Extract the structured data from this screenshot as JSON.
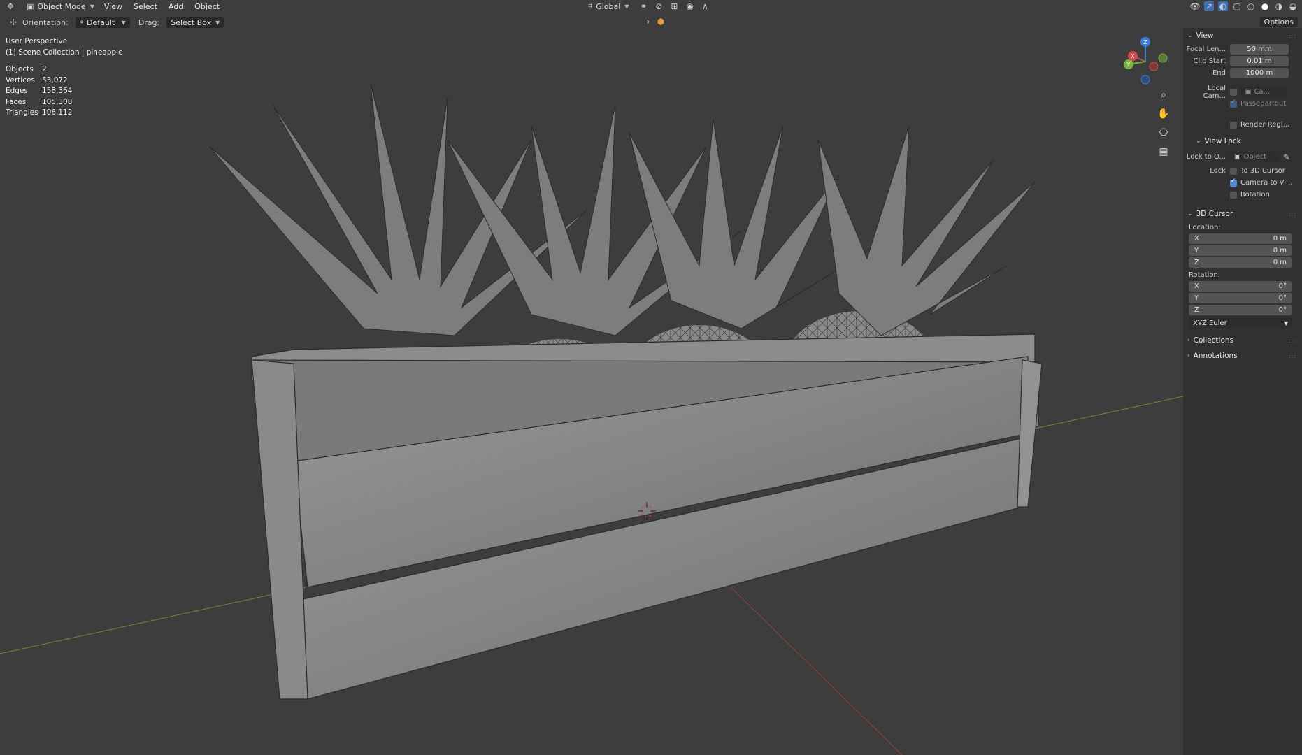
{
  "header": {
    "mode": "Object Mode",
    "menus": [
      "View",
      "Select",
      "Add",
      "Object"
    ],
    "transform_orientation": "Global"
  },
  "toolbar": {
    "orientation_label": "Orientation:",
    "orientation_value": "Default",
    "drag_label": "Drag:",
    "drag_value": "Select Box",
    "options_label": "Options"
  },
  "overlay": {
    "perspective": "User Perspective",
    "collection": "(1) Scene Collection | pineapple"
  },
  "stats": [
    {
      "label": "Objects",
      "value": "2"
    },
    {
      "label": "Vertices",
      "value": "53,072"
    },
    {
      "label": "Edges",
      "value": "158,364"
    },
    {
      "label": "Faces",
      "value": "105,308"
    },
    {
      "label": "Triangles",
      "value": "106,112"
    }
  ],
  "gizmo": {
    "x": "X",
    "y": "Y",
    "z": "Z"
  },
  "npanel": {
    "view": {
      "title": "View",
      "focal_label": "Focal Len...",
      "focal_value": "50 mm",
      "clip_start_label": "Clip Start",
      "clip_start_value": "0.01 m",
      "end_label": "End",
      "end_value": "1000 m",
      "local_cam_label": "Local Cam...",
      "local_cam_value": "Ca...",
      "passepartout": "Passepartout",
      "render_region": "Render Regi..."
    },
    "view_lock": {
      "title": "View Lock",
      "lock_to_label": "Lock to O...",
      "lock_to_placeholder": "Object",
      "lock_label": "Lock",
      "to_3d_cursor": "To 3D Cursor",
      "camera_to_view": "Camera to Vi...",
      "rotation": "Rotation"
    },
    "cursor": {
      "title": "3D Cursor",
      "location_label": "Location:",
      "location": [
        {
          "axis": "X",
          "value": "0 m"
        },
        {
          "axis": "Y",
          "value": "0 m"
        },
        {
          "axis": "Z",
          "value": "0 m"
        }
      ],
      "rotation_label": "Rotation:",
      "rotation": [
        {
          "axis": "X",
          "value": "0°"
        },
        {
          "axis": "Y",
          "value": "0°"
        },
        {
          "axis": "Z",
          "value": "0°"
        }
      ],
      "rotation_mode": "XYZ Euler"
    },
    "collections": "Collections",
    "annotations": "Annotations"
  }
}
